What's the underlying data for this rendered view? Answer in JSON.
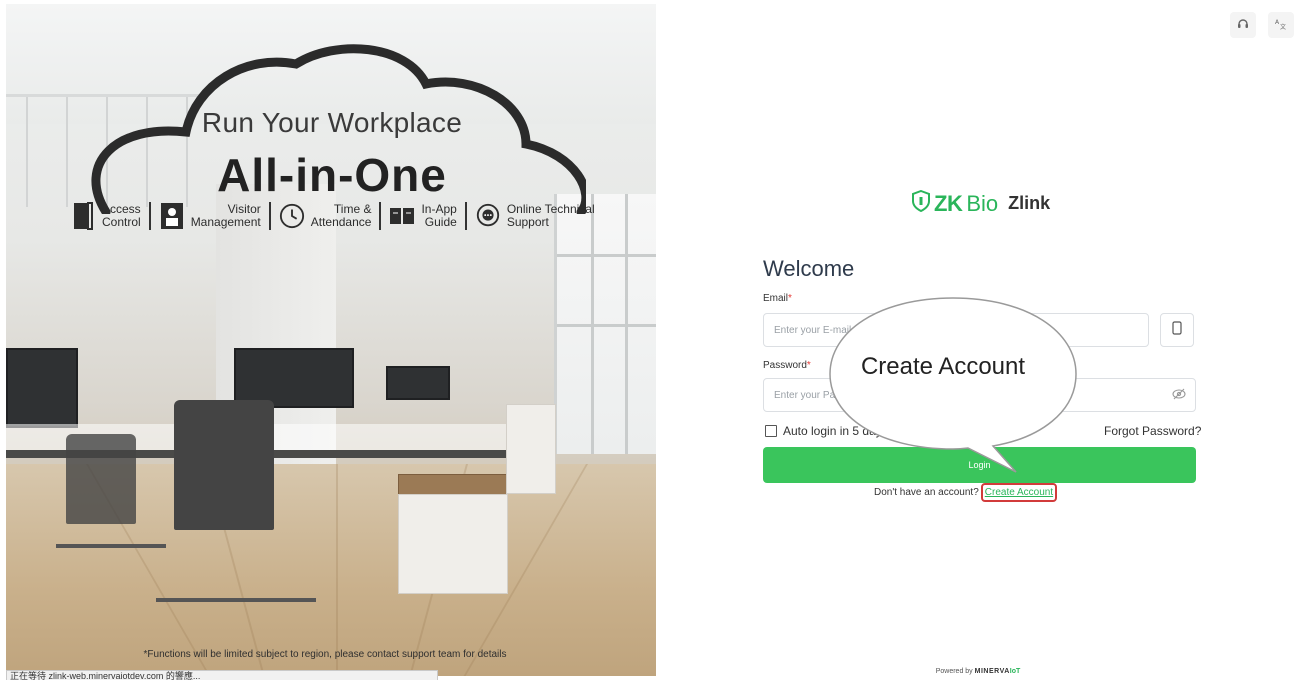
{
  "hero": {
    "tagline": "Run Your Workplace",
    "headline": "All-in-One",
    "features": [
      {
        "label": "Access\nControl",
        "icon": "door-icon"
      },
      {
        "label": "Visitor\nManagement",
        "icon": "visitor-badge-icon"
      },
      {
        "label": "Time &\nAttendance",
        "icon": "clock-icon"
      },
      {
        "label": "In-App\nGuide",
        "icon": "book-icon"
      },
      {
        "label": "Online Technical\nSupport",
        "icon": "chat-support-icon"
      }
    ],
    "disclaimer": "*Functions will be limited subject to region, please contact support team for details"
  },
  "status_bar": "正在等待 zlink-web.minervaiotdev.com 的響應...",
  "toolbar": {
    "support_icon": "headset-icon",
    "language_icon": "translate-icon"
  },
  "brand": {
    "zk": "ZK",
    "bio": "Bio",
    "product": "Zlink"
  },
  "login": {
    "welcome": "Welcome",
    "email_label": "Email",
    "email_placeholder": "Enter your E-mail (Username)",
    "password_label": "Password",
    "password_placeholder": "Enter your Password",
    "auto_login": "Auto login in 5 days",
    "forgot": "Forgot Password?",
    "login_button": "Login",
    "no_account": "Don't have an account?",
    "create_account": "Create Account"
  },
  "callout": {
    "text": "Create Account"
  },
  "footer": {
    "powered_by": "Powered by",
    "brand": "MINERVA",
    "brand_suffix": "IoT"
  },
  "colors": {
    "accent": "#3ac55c",
    "highlight_border": "#d23b3b"
  }
}
